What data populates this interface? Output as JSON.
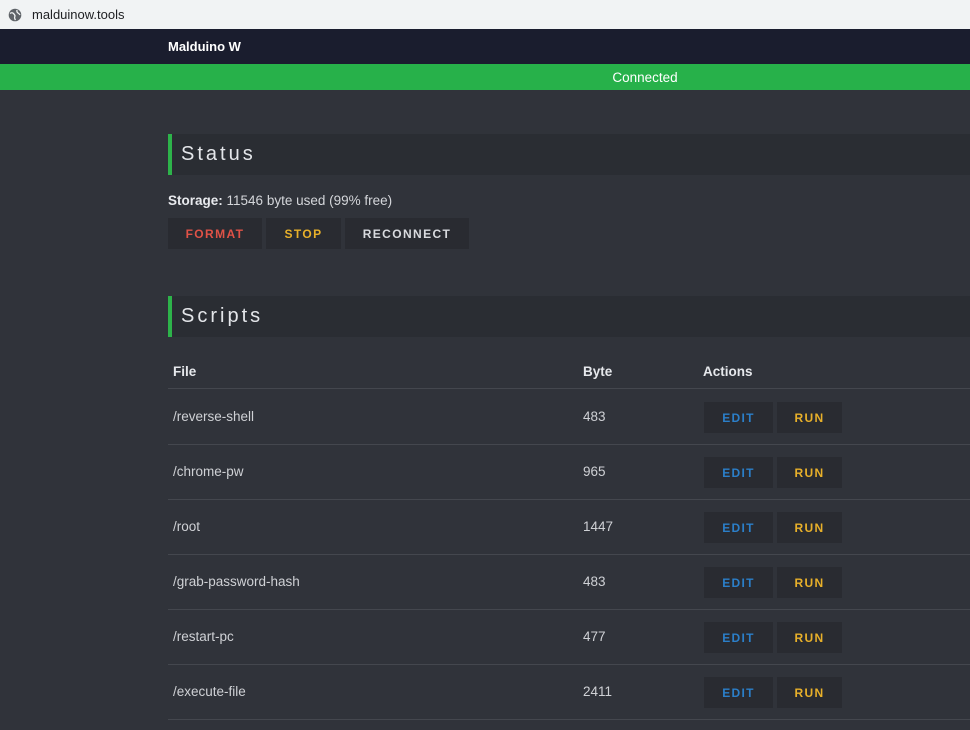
{
  "browser": {
    "url": "malduinow.tools"
  },
  "app": {
    "brand": "Malduino W",
    "connection_status": "Connected"
  },
  "status": {
    "heading": "Status",
    "storage_label": "Storage:",
    "storage_text": "11546 byte used (99% free)",
    "buttons": {
      "format": "FORMAT",
      "stop": "STOP",
      "reconnect": "RECONNECT"
    }
  },
  "scripts": {
    "heading": "Scripts",
    "columns": {
      "file": "File",
      "byte": "Byte",
      "actions": "Actions"
    },
    "action_labels": {
      "edit": "EDIT",
      "run": "RUN"
    },
    "rows": [
      {
        "file": "/reverse-shell",
        "byte": "483"
      },
      {
        "file": "/chrome-pw",
        "byte": "965"
      },
      {
        "file": "/root",
        "byte": "1447"
      },
      {
        "file": "/grab-password-hash",
        "byte": "483"
      },
      {
        "file": "/restart-pc",
        "byte": "477"
      },
      {
        "file": "/execute-file",
        "byte": "2411"
      }
    ]
  },
  "colors": {
    "connected": "#27b14a",
    "format": "#e05247",
    "run": "#e8b02a",
    "edit": "#2b7fc9"
  }
}
